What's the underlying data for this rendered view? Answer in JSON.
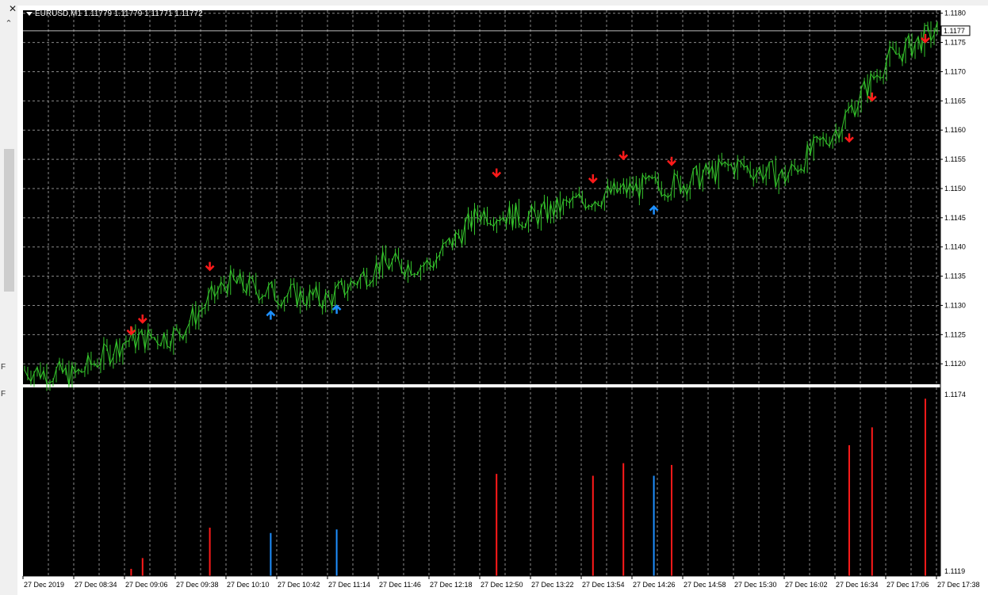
{
  "window": {
    "title": "EURUSD,M1  1.11779 1.11779 1.11771 1.11772",
    "close_glyph": "✕",
    "scroll_up_glyph": "⌃",
    "left_ticks": [
      "F",
      "F"
    ]
  },
  "colors": {
    "background": "#000000",
    "grid": "#8a8a8a",
    "candles": "#35c52c",
    "sell_signal": "#ff1a1a",
    "buy_signal": "#1e90ff",
    "axis_bg": "#ffffff"
  },
  "price_axis": {
    "ticks": [
      "1.1180",
      "1.1175",
      "1.1170",
      "1.1165",
      "1.1160",
      "1.1155",
      "1.1150",
      "1.1145",
      "1.1140",
      "1.1135",
      "1.1130",
      "1.1125",
      "1.1120"
    ],
    "current_price": "1.1177",
    "ylim": [
      1.11165,
      1.11805
    ]
  },
  "indicator_axis": {
    "top_label": "1.1174",
    "bottom_label": "1.1119"
  },
  "time_axis": {
    "labels": [
      "27 Dec 2019",
      "27 Dec 08:34",
      "27 Dec 09:06",
      "27 Dec 09:38",
      "27 Dec 10:10",
      "27 Dec 10:42",
      "27 Dec 11:14",
      "27 Dec 11:46",
      "27 Dec 12:18",
      "27 Dec 12:50",
      "27 Dec 13:22",
      "27 Dec 13:54",
      "27 Dec 14:26",
      "27 Dec 14:58",
      "27 Dec 15:30",
      "27 Dec 16:02",
      "27 Dec 16:34",
      "27 Dec 17:06",
      "27 Dec 17:38"
    ]
  },
  "chart_data": {
    "type": "line",
    "series": [
      {
        "name": "EURUSD,M1",
        "x": [
          "27 Dec 2019",
          "27 Dec 08:34",
          "27 Dec 09:06",
          "27 Dec 09:38",
          "27 Dec 10:10",
          "27 Dec 10:42",
          "27 Dec 11:14",
          "27 Dec 11:46",
          "27 Dec 12:18",
          "27 Dec 12:50",
          "27 Dec 13:22",
          "27 Dec 13:54",
          "27 Dec 14:26",
          "27 Dec 14:58",
          "27 Dec 15:30",
          "27 Dec 16:02",
          "27 Dec 16:34",
          "27 Dec 17:06",
          "27 Dec 17:38"
        ],
        "values": [
          1.1119,
          1.1118,
          1.1124,
          1.1125,
          1.1134,
          1.1132,
          1.1131,
          1.1137,
          1.1137,
          1.1146,
          1.1145,
          1.1148,
          1.115,
          1.1151,
          1.1154,
          1.1152,
          1.116,
          1.1172,
          1.1177
        ]
      }
    ],
    "signals": [
      {
        "type": "sell",
        "time_index": 4.2,
        "price": 1.1124
      },
      {
        "type": "sell",
        "time_index": 4.65,
        "price": 1.1126
      },
      {
        "type": "sell",
        "time_index": 7.3,
        "price": 1.1135
      },
      {
        "type": "buy",
        "time_index": 9.7,
        "price": 1.113
      },
      {
        "type": "buy",
        "time_index": 12.3,
        "price": 1.1131
      },
      {
        "type": "sell",
        "time_index": 18.6,
        "price": 1.1151
      },
      {
        "type": "sell",
        "time_index": 22.4,
        "price": 1.115
      },
      {
        "type": "sell",
        "time_index": 23.6,
        "price": 1.1154
      },
      {
        "type": "buy",
        "time_index": 24.8,
        "price": 1.1148
      },
      {
        "type": "sell",
        "time_index": 25.5,
        "price": 1.1153
      },
      {
        "type": "sell",
        "time_index": 32.5,
        "price": 1.1157
      },
      {
        "type": "sell",
        "time_index": 33.4,
        "price": 1.1164
      },
      {
        "type": "sell",
        "time_index": 35.5,
        "price": 1.1174
      }
    ],
    "indicator_bars": [
      {
        "type": "sell",
        "time_index": 4.2,
        "level": 0.04
      },
      {
        "type": "sell",
        "time_index": 4.65,
        "level": 0.1
      },
      {
        "type": "sell",
        "time_index": 7.3,
        "level": 0.27
      },
      {
        "type": "buy",
        "time_index": 9.7,
        "level": 0.24
      },
      {
        "type": "buy",
        "time_index": 12.3,
        "level": 0.26
      },
      {
        "type": "sell",
        "time_index": 18.6,
        "level": 0.57
      },
      {
        "type": "sell",
        "time_index": 22.4,
        "level": 0.56
      },
      {
        "type": "sell",
        "time_index": 23.6,
        "level": 0.63
      },
      {
        "type": "buy",
        "time_index": 24.8,
        "level": 0.56
      },
      {
        "type": "sell",
        "time_index": 25.5,
        "level": 0.62
      },
      {
        "type": "sell",
        "time_index": 32.5,
        "level": 0.73
      },
      {
        "type": "sell",
        "time_index": 33.4,
        "level": 0.83
      },
      {
        "type": "sell",
        "time_index": 35.5,
        "level": 0.99
      }
    ]
  }
}
